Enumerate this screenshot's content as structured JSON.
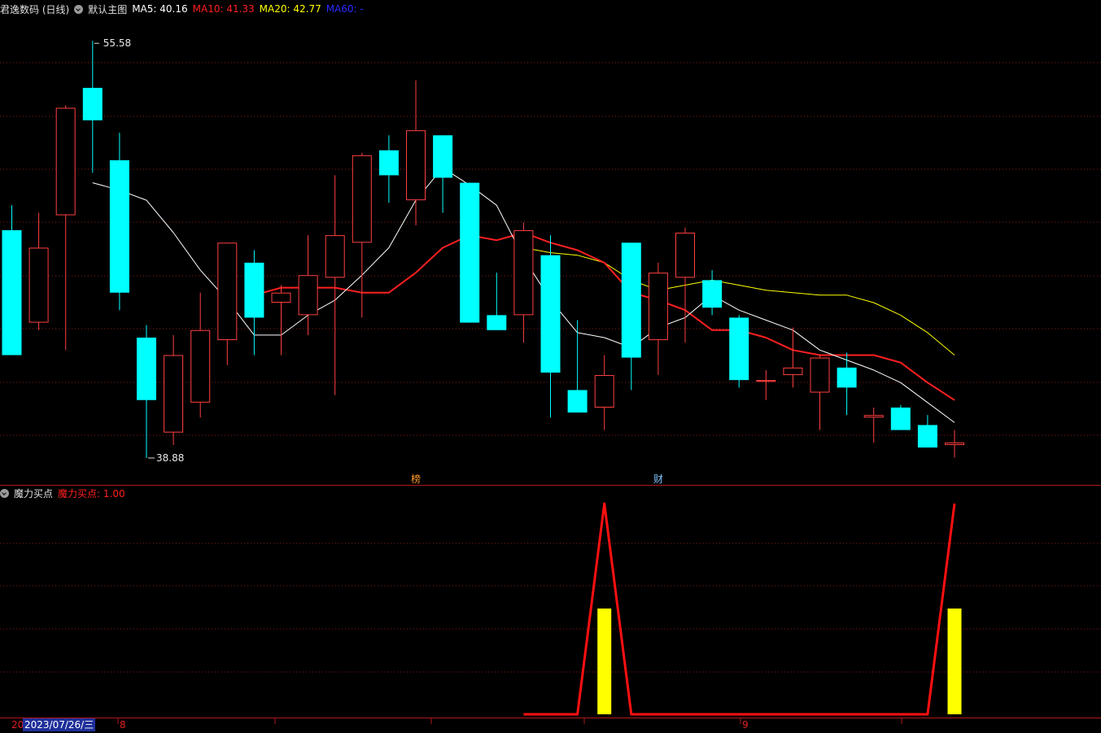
{
  "header": {
    "stock_title": "君逸数码 (日线)",
    "main_chart_label": "默认主图",
    "ma5": "MA5: 40.16",
    "ma10": "MA10: 41.33",
    "ma20": "MA20: 42.77",
    "ma60": "MA60: -"
  },
  "indicator_header": {
    "name": "魔力买点",
    "value_text": "魔力买点: 1.00"
  },
  "markers": {
    "rank_label": "榜",
    "finance_label": "财"
  },
  "date_axis": {
    "year_prefix": "20",
    "selected_date": "2023/07/26/三",
    "month_8": "8",
    "month_9": "9"
  },
  "colors": {
    "up": "#ff4040",
    "down": "#00ffff",
    "ma5": "#ffffff",
    "ma10": "#ff2020",
    "ma20": "#ffff00",
    "ma60": "#1a1aff",
    "panel_line": "#ff1010",
    "panel_bar": "#ffff00",
    "grid": "#8b1a1a"
  },
  "chart_data": {
    "type": "candlestick",
    "price_high_label": "55.58",
    "price_low_label": "38.88",
    "ylim": [
      38.0,
      56.5
    ],
    "candles": [
      {
        "o": 48.0,
        "h": 49.0,
        "l": 43.5,
        "c": 43.0
      },
      {
        "o": 44.3,
        "h": 48.7,
        "l": 44.0,
        "c": 47.3
      },
      {
        "o": 48.6,
        "h": 53.0,
        "l": 43.2,
        "c": 52.9
      },
      {
        "o": 53.7,
        "h": 55.58,
        "l": 50.3,
        "c": 52.4
      },
      {
        "o": 50.8,
        "h": 51.9,
        "l": 44.8,
        "c": 45.5
      },
      {
        "o": 43.7,
        "h": 44.2,
        "l": 38.88,
        "c": 41.2
      },
      {
        "o": 39.9,
        "h": 43.8,
        "l": 39.4,
        "c": 43.0
      },
      {
        "o": 41.1,
        "h": 45.5,
        "l": 40.5,
        "c": 44.0
      },
      {
        "o": 43.6,
        "h": 47.3,
        "l": 42.6,
        "c": 47.5
      },
      {
        "o": 46.7,
        "h": 47.2,
        "l": 43.0,
        "c": 44.5
      },
      {
        "o": 45.1,
        "h": 45.8,
        "l": 43.0,
        "c": 45.5
      },
      {
        "o": 44.6,
        "h": 47.8,
        "l": 43.8,
        "c": 46.2
      },
      {
        "o": 46.1,
        "h": 50.2,
        "l": 41.4,
        "c": 47.8
      },
      {
        "o": 47.5,
        "h": 51.1,
        "l": 44.5,
        "c": 51.0
      },
      {
        "o": 51.2,
        "h": 51.8,
        "l": 49.1,
        "c": 50.2
      },
      {
        "o": 49.2,
        "h": 54.0,
        "l": 48.2,
        "c": 52.0
      },
      {
        "o": 51.8,
        "h": 51.6,
        "l": 48.7,
        "c": 50.1
      },
      {
        "o": 49.9,
        "h": 49.8,
        "l": 44.5,
        "c": 44.3
      },
      {
        "o": 44.6,
        "h": 46.3,
        "l": 44.1,
        "c": 44.0
      },
      {
        "o": 44.6,
        "h": 48.3,
        "l": 43.5,
        "c": 48.0
      },
      {
        "o": 47.0,
        "h": 47.8,
        "l": 40.5,
        "c": 42.3
      },
      {
        "o": 41.6,
        "h": 44.4,
        "l": 40.9,
        "c": 40.7
      },
      {
        "o": 40.9,
        "h": 43.0,
        "l": 40.0,
        "c": 42.2
      },
      {
        "o": 47.5,
        "h": 47.5,
        "l": 41.6,
        "c": 42.9
      },
      {
        "o": 43.6,
        "h": 46.7,
        "l": 42.2,
        "c": 46.3
      },
      {
        "o": 46.1,
        "h": 48.1,
        "l": 43.5,
        "c": 47.9
      },
      {
        "o": 46.0,
        "h": 46.4,
        "l": 44.6,
        "c": 44.9
      },
      {
        "o": 44.5,
        "h": 44.6,
        "l": 41.7,
        "c": 42.0
      },
      {
        "o": 42.0,
        "h": 42.4,
        "l": 41.2,
        "c": 42.0
      },
      {
        "o": 42.2,
        "h": 44.1,
        "l": 41.7,
        "c": 42.5
      },
      {
        "o": 41.5,
        "h": 43.0,
        "l": 40.0,
        "c": 42.9
      },
      {
        "o": 42.5,
        "h": 43.1,
        "l": 40.6,
        "c": 41.7
      },
      {
        "o": 40.5,
        "h": 40.9,
        "l": 39.5,
        "c": 40.6
      },
      {
        "o": 40.9,
        "h": 41.0,
        "l": 40.0,
        "c": 40.0
      },
      {
        "o": 40.2,
        "h": 40.6,
        "l": 39.9,
        "c": 39.3
      },
      {
        "o": 39.4,
        "h": 40.0,
        "l": 38.9,
        "c": 39.5
      }
    ],
    "ma5": [
      null,
      null,
      null,
      49.9,
      49.6,
      49.2,
      47.9,
      46.4,
      45.2,
      43.8,
      43.8,
      44.6,
      45.2,
      46.2,
      47.3,
      49.2,
      50.5,
      49.8,
      49.0,
      46.9,
      45.2,
      43.9,
      43.7,
      43.3,
      44.1,
      44.5,
      45.4,
      44.8,
      44.4,
      44.0,
      43.2,
      42.8,
      42.4,
      41.9,
      41.1,
      40.3
    ],
    "ma10": [
      null,
      null,
      null,
      null,
      null,
      null,
      null,
      null,
      null,
      45.4,
      45.7,
      45.7,
      45.7,
      45.5,
      45.5,
      46.3,
      47.3,
      47.8,
      47.6,
      47.9,
      47.5,
      47.2,
      46.7,
      45.5,
      45.2,
      44.8,
      44.0,
      44.0,
      43.7,
      43.2,
      43.0,
      43.0,
      43.0,
      42.7,
      41.9,
      41.2
    ],
    "ma20": [
      null,
      null,
      null,
      null,
      null,
      null,
      null,
      null,
      null,
      null,
      null,
      null,
      null,
      null,
      null,
      null,
      null,
      null,
      null,
      47.3,
      47.1,
      47.0,
      46.7,
      46.0,
      45.6,
      45.8,
      46.0,
      45.8,
      45.6,
      45.5,
      45.4,
      45.4,
      45.1,
      44.6,
      43.9,
      43.0
    ],
    "indicator": [
      null,
      null,
      null,
      null,
      null,
      null,
      null,
      null,
      null,
      null,
      null,
      null,
      null,
      null,
      null,
      null,
      null,
      null,
      null,
      0,
      0,
      0,
      1,
      0,
      0,
      0,
      0,
      0,
      0,
      0,
      0,
      0,
      0,
      0,
      0,
      1
    ],
    "indicator_ylim": [
      0,
      1
    ]
  }
}
